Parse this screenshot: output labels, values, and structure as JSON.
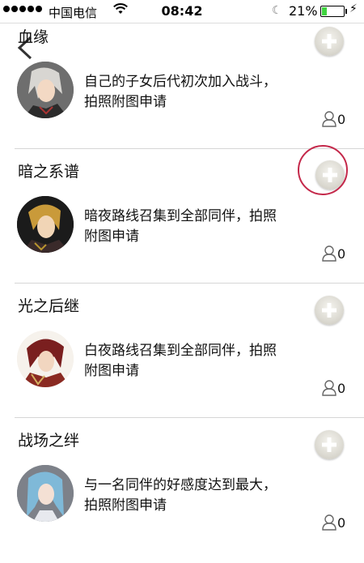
{
  "status_bar": {
    "carrier": "中国电信",
    "time": "08:42",
    "battery_percent": "21%",
    "battery_level": 0.21
  },
  "achievements": [
    {
      "title": "血缘",
      "description": "自己的子女后代初次加入战斗，拍照附图申请",
      "count": "0",
      "avatar_icon": "character-portrait-silver-hair"
    },
    {
      "title": "暗之系谱",
      "description": "暗夜路线召集到全部同伴，拍照附图申请",
      "count": "0",
      "avatar_icon": "character-portrait-blond-hair"
    },
    {
      "title": "光之后继",
      "description": "白夜路线召集到全部同伴，拍照附图申请",
      "count": "0",
      "avatar_icon": "character-portrait-red-armor"
    },
    {
      "title": "战场之绊",
      "description": "与一名同伴的好感度达到最大，拍照附图申请",
      "count": "0",
      "avatar_icon": "character-portrait-blue-hair"
    }
  ],
  "colors": {
    "highlight": "#c4284a",
    "divider": "#d6d6d6",
    "battery": "#3fd43f"
  }
}
